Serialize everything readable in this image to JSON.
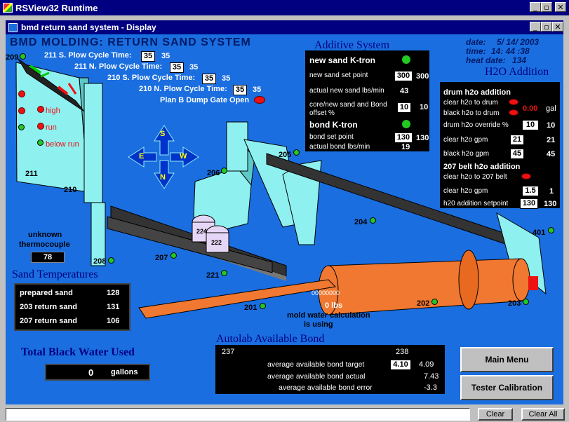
{
  "app": {
    "title": "RSView32 Runtime"
  },
  "display": {
    "title": "bmd return sand system - Display",
    "heading": "BMD MOLDING: RETURN SAND SYSTEM"
  },
  "datetime": {
    "date_label": "date:",
    "date": "5/ 14/ 2003",
    "time_label": "time:",
    "time": "14: 44 :38",
    "heat_label": "heat date:",
    "heat": "134"
  },
  "plow": [
    {
      "label": "211 S. Plow Cycle Time:",
      "set": "35",
      "actual": "35"
    },
    {
      "label": "211 N. Plow Cycle Time:",
      "set": "35",
      "actual": "35"
    },
    {
      "label": "210 S. Plow Cycle Time:",
      "set": "35",
      "actual": "35"
    },
    {
      "label": "210 N. Plow Cycle Time:",
      "set": "35",
      "actual": "35"
    }
  ],
  "plan_b": "Plan B Dump Gate Open",
  "bin_levels": {
    "high": "high",
    "run": "run",
    "below": "below run"
  },
  "tags": {
    "t209": "209",
    "t211": "211",
    "t210": "210",
    "t208": "208",
    "t207": "207",
    "t206": "206",
    "t205": "205",
    "t204": "204",
    "t221": "221",
    "t224": "224",
    "t222": "222",
    "t201": "201",
    "t202": "202",
    "t203": "203",
    "t401": "401"
  },
  "compass": {
    "s": "S",
    "e": "E",
    "w": "W",
    "n": "N"
  },
  "thermo": {
    "label1": "unknown",
    "label2": "thermocouple",
    "value": "78"
  },
  "sand_temps": {
    "title": "Sand Temperatures",
    "rows": [
      {
        "label": "prepared sand",
        "value": "128"
      },
      {
        "label": "203 return sand",
        "value": "131"
      },
      {
        "label": "207 return sand",
        "value": "106"
      }
    ]
  },
  "black_water": {
    "title": "Total Black Water Used",
    "value": "0",
    "unit": "gallons"
  },
  "additive": {
    "title": "Additive System",
    "new_sand_title": "new sand K-tron",
    "new_sand_set_label": "new sand set point",
    "new_sand_set": "300",
    "new_sand_set_act": "300",
    "actual_new_label": "actual new sand lbs/min",
    "actual_new": "43",
    "core_label1": "core/new sand and Bond",
    "core_label2": "offset %",
    "core_set": "10",
    "core_act": "10",
    "bond_title": "bond K-tron",
    "bond_set_label": "bond set point",
    "bond_set": "130",
    "bond_set_act": "130",
    "actual_bond_label": "actual bond lbs/min",
    "actual_bond": "19"
  },
  "h2o": {
    "title": "H2O Addition",
    "drum_title": "drum h2o addition",
    "clear_drum_label": "clear h2o to drum",
    "black_drum_label": "black h2o to drum",
    "gal_value": "0.00",
    "gal_unit": "gal",
    "override_label": "drum h2o override %",
    "override_set": "10",
    "override_act": "10",
    "clear_gpm_label": "clear h2o gpm",
    "clear_gpm_set": "21",
    "clear_gpm_act": "21",
    "black_gpm_label": "black h2o gpm",
    "black_gpm_set": "45",
    "black_gpm_act": "45",
    "belt_title": "207 belt h2o addition",
    "clear_belt_label": "clear h2o to 207 belt",
    "belt_gpm_label": "clear h2o gpm",
    "belt_gpm_set": "1.5",
    "belt_gpm_act": "1",
    "setpoint_label": "h20 addition setpoint",
    "setpoint_set": "130",
    "setpoint_act": "130"
  },
  "mold_water": {
    "code": "00000000",
    "lbs": "0 lbs",
    "line1": "mold water calculation",
    "line2": "is using"
  },
  "autolab": {
    "title": "Autolab Available Bond",
    "col1": "237",
    "col2": "238",
    "target_label": "average available bond target",
    "target_set": "4.10",
    "target_act": "4.09",
    "actual_label": "average available bond actual",
    "actual": "7.43",
    "error_label": "average available bond error",
    "error": "-3.3"
  },
  "buttons": {
    "main_menu": "Main Menu",
    "tester": "Tester Calibration"
  },
  "status": {
    "clear": "Clear",
    "clear_all": "Clear All"
  },
  "colors": {
    "background": "#1a6ee0",
    "equipment": "#8ff0f0",
    "drum": "#f07830",
    "title_navy": "#000080"
  }
}
